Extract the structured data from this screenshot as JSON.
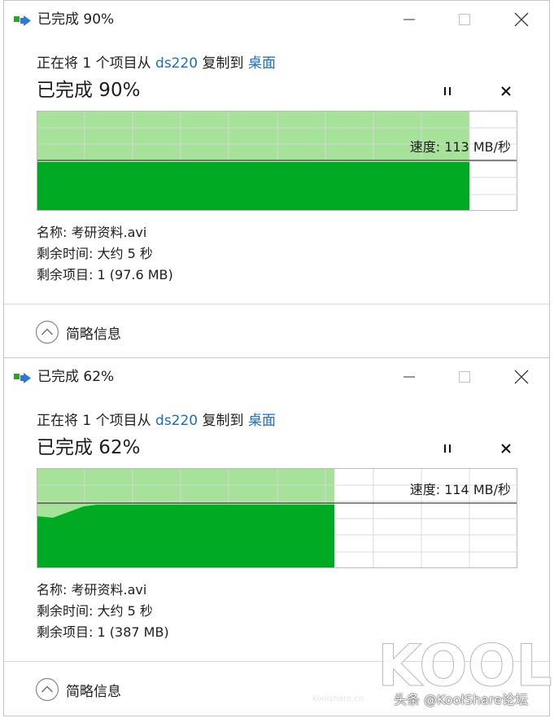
{
  "dialogs": [
    {
      "window_title": "已完成 90%",
      "copy_prefix": "正在将 1 个项目从",
      "source": "ds220",
      "copy_middle": "复制到",
      "destination": "桌面",
      "progress_title": "已完成 90%",
      "progress_fraction": 0.9,
      "speed_label": "速度: 113 MB/秒",
      "name_label": "名称:",
      "name_value": "考研资料.avi",
      "time_label": "剩余时间:",
      "time_value": "大约 5 秒",
      "items_label": "剩余项目:",
      "items_value": "1 (97.6 MB)",
      "less_details": "简略信息"
    },
    {
      "window_title": "已完成 62%",
      "copy_prefix": "正在将 1 个项目从",
      "source": "ds220",
      "copy_middle": "复制到",
      "destination": "桌面",
      "progress_title": "已完成 62%",
      "progress_fraction": 0.62,
      "speed_label": "速度: 114 MB/秒",
      "name_label": "名称:",
      "name_value": "考研资料.avi",
      "time_label": "剩余时间:",
      "time_value": "大约 5 秒",
      "items_label": "剩余项目:",
      "items_value": "1 (387 MB)",
      "less_details": "简略信息"
    }
  ],
  "watermark": {
    "brand": "KOOL",
    "credit": "头条 @KoolShare论坛",
    "site": "koolshare.cn"
  },
  "colors": {
    "chart_fill": "#00aa22",
    "chart_fill_light": "#a6e29a",
    "chart_grid": "#d8d8d8",
    "link": "#1a6fb5"
  }
}
